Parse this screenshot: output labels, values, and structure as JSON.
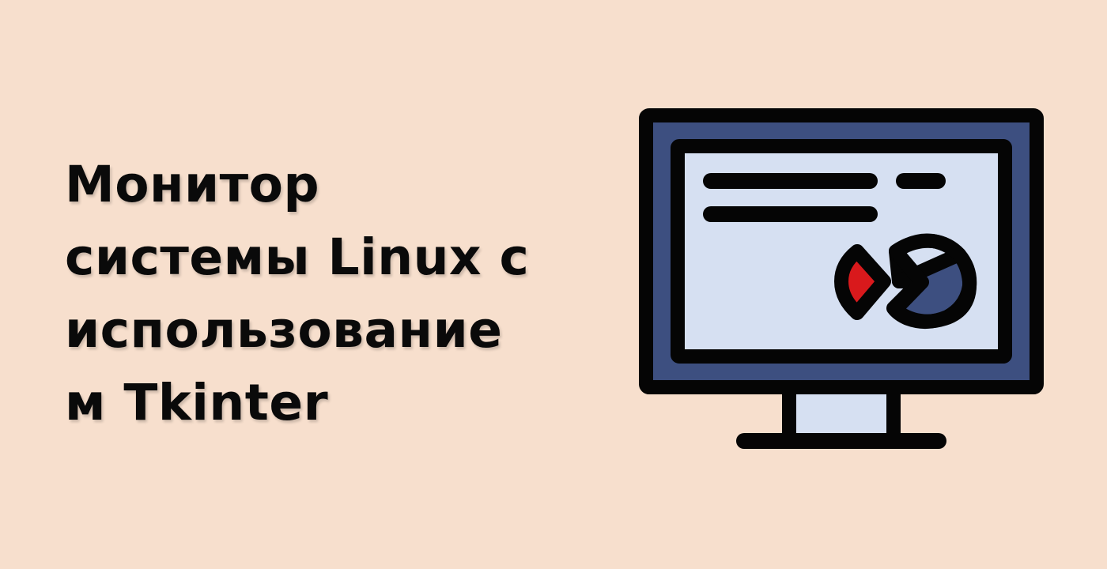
{
  "background_color": "#f7dfcd",
  "title": {
    "lines": [
      "Монитор",
      "системы Linux с",
      "использование",
      "м Tkinter"
    ]
  },
  "illustration": {
    "icon": "monitor-with-dashboard-icon",
    "colors": {
      "outline": "#050505",
      "bezel": "#3d4f80",
      "screen": "#d6e0f2",
      "chart_red": "#d9191c",
      "chart_blue": "#3d4f80"
    }
  }
}
